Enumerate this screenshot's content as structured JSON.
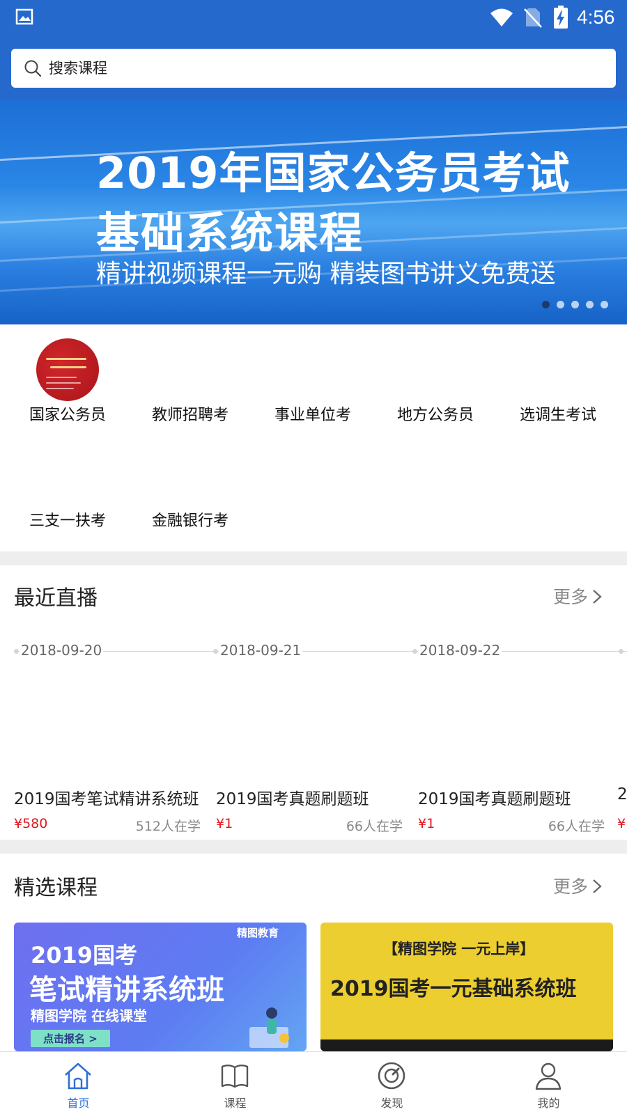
{
  "status_bar": {
    "time": "4:56"
  },
  "search": {
    "placeholder": "搜索课程"
  },
  "banner": {
    "line1": "2019年国家公务员考试",
    "line2": "基础系统课程",
    "line3": "精讲视频课程一元购  精装图书讲义免费送",
    "slide_count": 5,
    "active_slide": 1
  },
  "categories": {
    "items": [
      "国家公务员",
      "教师招聘考",
      "事业单位考",
      "地方公务员",
      "选调生考试",
      "三支一扶考",
      "金融银行考"
    ]
  },
  "recent_live": {
    "title": "最近直播",
    "more_label": "更多",
    "cards": [
      {
        "date": "2018-09-20",
        "title": "2019国考笔试精讲系统班",
        "price": "¥580",
        "learners": "512人在学"
      },
      {
        "date": "2018-09-21",
        "title": "2019国考真题刷题班",
        "price": "¥1",
        "learners": "66人在学"
      },
      {
        "date": "2018-09-22",
        "title": "2019国考真题刷题班",
        "price": "¥1",
        "learners": "66人在学"
      },
      {
        "title": "2",
        "price": "¥"
      }
    ]
  },
  "featured": {
    "title": "精选课程",
    "more_label": "更多",
    "courses": [
      {
        "brand": "精图教育",
        "line1": "2019国考",
        "line2": "笔试精讲系统班",
        "line3": "精图学院 在线课堂",
        "cta": "点击报名 >"
      },
      {
        "line1": "【精图学院  一元上岸】",
        "line2": "2019国考一元基础系统班"
      }
    ]
  },
  "bottom_nav": {
    "items": [
      {
        "label": "首页",
        "icon": "home-icon",
        "active": true
      },
      {
        "label": "课程",
        "icon": "book-icon",
        "active": false
      },
      {
        "label": "发现",
        "icon": "discover-icon",
        "active": false
      },
      {
        "label": "我的",
        "icon": "user-icon",
        "active": false
      }
    ]
  },
  "colors": {
    "primary": "#2569cd",
    "price_red": "#e0181e",
    "nav_active": "#2e6fd6",
    "section_gap": "#eeeeee"
  }
}
